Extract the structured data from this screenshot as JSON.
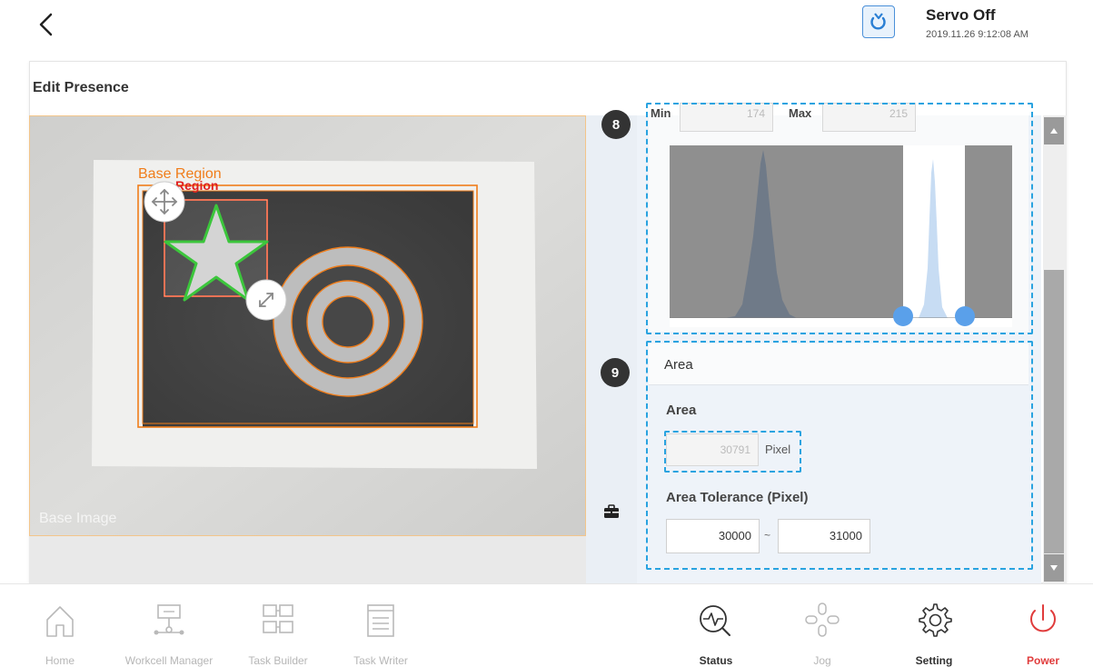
{
  "header": {
    "servo_status": "Servo Off",
    "datetime": "2019.11.26 9:12:08 AM"
  },
  "page": {
    "title": "Edit Presence"
  },
  "camera": {
    "label_base_region": "Base Region",
    "label_region": "Region",
    "label_base_image": "Base Image"
  },
  "histogram": {
    "min_label": "Min",
    "max_label": "Max",
    "min_value": "174",
    "max_value": "215"
  },
  "area_section": {
    "header": "Area",
    "area_label": "Area",
    "area_value": "30791",
    "area_unit": "Pixel",
    "tolerance_label": "Area Tolerance (Pixel)",
    "tolerance_min": "30000",
    "tolerance_separator": "~",
    "tolerance_max": "31000"
  },
  "callouts": [
    "8",
    "9"
  ],
  "nav": {
    "home": "Home",
    "workcell": "Workcell Manager",
    "task_builder": "Task Builder",
    "task_writer": "Task Writer",
    "status": "Status",
    "jog": "Jog",
    "setting": "Setting",
    "power": "Power"
  },
  "colors": {
    "accent": "#29a3e0",
    "power": "#e03c3c",
    "region_base": "#f07d1a",
    "region": "#e02020",
    "shape_detect": "#3cc63c",
    "handle_blue": "#5aa0ea"
  }
}
